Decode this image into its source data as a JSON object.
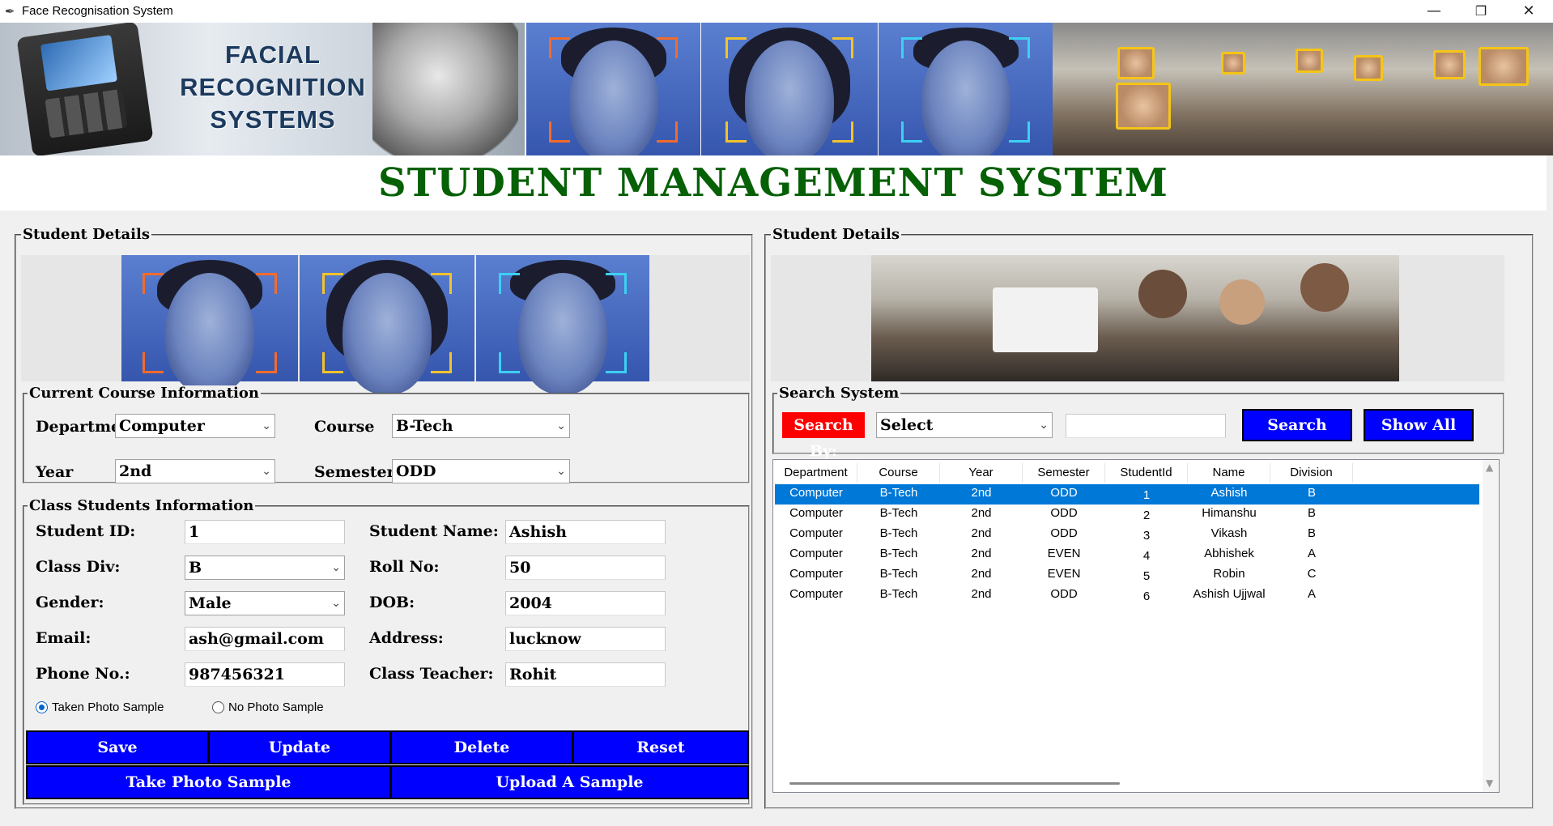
{
  "window": {
    "title": "Face Recognisation System",
    "controls": [
      "—",
      "❐",
      "✕"
    ]
  },
  "banner": {
    "logo_text": "FACIAL RECOGNITION SYSTEMS"
  },
  "main_title": "STUDENT MANAGEMENT SYSTEM",
  "left_panel": {
    "legend": "Student Details",
    "course": {
      "legend": "Current Course Information",
      "department_label": "Department",
      "department_value": "Computer",
      "course_label": "Course",
      "course_value": "B-Tech",
      "year_label": "Year",
      "year_value": "2nd",
      "semester_label": "Semester",
      "semester_value": "ODD"
    },
    "class": {
      "legend": "Class Students Information",
      "student_id_label": "Student ID:",
      "student_id_value": "1",
      "student_name_label": "Student Name:",
      "student_name_value": "Ashish",
      "class_div_label": "Class Div:",
      "class_div_value": "B",
      "roll_no_label": "Roll No:",
      "roll_no_value": "50",
      "gender_label": "Gender:",
      "gender_value": "Male",
      "dob_label": "DOB:",
      "dob_value": "2004",
      "email_label": "Email:",
      "email_value": "ash@gmail.com",
      "address_label": "Address:",
      "address_value": "lucknow",
      "phone_label": "Phone No.:",
      "phone_value": "987456321",
      "teacher_label": "Class Teacher:",
      "teacher_value": "Rohit",
      "radio_taken": "Taken Photo Sample",
      "radio_none": "No Photo Sample",
      "radio_selected": "Taken Photo Sample"
    },
    "buttons": {
      "save": "Save",
      "update": "Update",
      "delete": "Delete",
      "reset": "Reset",
      "take_photo": "Take Photo Sample",
      "upload": "Upload A Sample"
    }
  },
  "right_panel": {
    "legend": "Student Details",
    "search": {
      "legend": "Search System",
      "search_by_label": "Search By:",
      "select_value": "Select",
      "search_text": "",
      "search_button": "Search",
      "show_all_button": "Show All"
    },
    "table": {
      "columns": [
        "Department",
        "Course",
        "Year",
        "Semester",
        "StudentId",
        "Name",
        "Division"
      ],
      "rows": [
        [
          "Computer",
          "B-Tech",
          "2nd",
          "ODD",
          "1",
          "Ashish",
          "B"
        ],
        [
          "Computer",
          "B-Tech",
          "2nd",
          "ODD",
          "2",
          "Himanshu",
          "B"
        ],
        [
          "Computer",
          "B-Tech",
          "2nd",
          "ODD",
          "3",
          "Vikash",
          "B"
        ],
        [
          "Computer",
          "B-Tech",
          "2nd",
          "EVEN",
          "4",
          "Abhishek",
          "A"
        ],
        [
          "Computer",
          "B-Tech",
          "2nd",
          "EVEN",
          "5",
          "Robin",
          "C"
        ],
        [
          "Computer",
          "B-Tech",
          "2nd",
          "ODD",
          "6",
          "Ashish Ujjwal",
          "A"
        ]
      ],
      "selected_row": 0
    }
  },
  "colors": {
    "title_green": "#066006",
    "button_blue": "#0000ff",
    "search_red": "#ff0000",
    "selection_blue": "#0078d7"
  }
}
